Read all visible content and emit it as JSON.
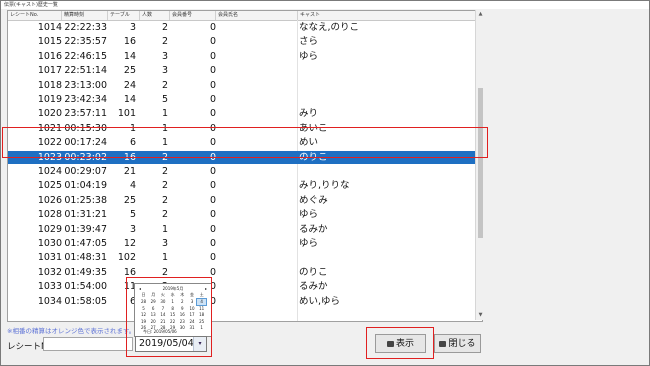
{
  "window": {
    "title": "伝票(キャスト)歴史一覧"
  },
  "columns": [
    "レシートNo.",
    "精算時刻",
    "テーブル",
    "人数",
    "会員番号",
    "会員氏名",
    "キャスト"
  ],
  "rows": [
    {
      "rec": "1014",
      "time": "22:22:33",
      "table": "3",
      "ppl": "2",
      "memno": "0",
      "memname": "",
      "cast": "ななえ,のりこ"
    },
    {
      "rec": "1015",
      "time": "22:35:57",
      "table": "16",
      "ppl": "2",
      "memno": "0",
      "memname": "",
      "cast": "さら"
    },
    {
      "rec": "1016",
      "time": "22:46:15",
      "table": "14",
      "ppl": "3",
      "memno": "0",
      "memname": "",
      "cast": "ゆら"
    },
    {
      "rec": "1017",
      "time": "22:51:14",
      "table": "25",
      "ppl": "3",
      "memno": "0",
      "memname": "",
      "cast": ""
    },
    {
      "rec": "1018",
      "time": "23:13:00",
      "table": "24",
      "ppl": "2",
      "memno": "0",
      "memname": "",
      "cast": ""
    },
    {
      "rec": "1019",
      "time": "23:42:34",
      "table": "14",
      "ppl": "5",
      "memno": "0",
      "memname": "",
      "cast": ""
    },
    {
      "rec": "1020",
      "time": "23:57:11",
      "table": "101",
      "ppl": "1",
      "memno": "0",
      "memname": "",
      "cast": "みり"
    },
    {
      "rec": "1021",
      "time": "00:15:30",
      "table": "1",
      "ppl": "1",
      "memno": "0",
      "memname": "",
      "cast": "あいこ"
    },
    {
      "rec": "1022",
      "time": "00:17:24",
      "table": "6",
      "ppl": "1",
      "memno": "0",
      "memname": "",
      "cast": "めい"
    },
    {
      "rec": "1023",
      "time": "00:23:02",
      "table": "16",
      "ppl": "2",
      "memno": "0",
      "memname": "",
      "cast": "のりこ",
      "selected": true
    },
    {
      "rec": "1024",
      "time": "00:29:07",
      "table": "21",
      "ppl": "2",
      "memno": "0",
      "memname": "",
      "cast": ""
    },
    {
      "rec": "1025",
      "time": "01:04:19",
      "table": "4",
      "ppl": "2",
      "memno": "0",
      "memname": "",
      "cast": "みり,りりな"
    },
    {
      "rec": "1026",
      "time": "01:25:38",
      "table": "25",
      "ppl": "2",
      "memno": "0",
      "memname": "",
      "cast": "めぐみ"
    },
    {
      "rec": "1028",
      "time": "01:31:21",
      "table": "5",
      "ppl": "2",
      "memno": "0",
      "memname": "",
      "cast": "ゆら"
    },
    {
      "rec": "1029",
      "time": "01:39:47",
      "table": "3",
      "ppl": "1",
      "memno": "0",
      "memname": "",
      "cast": "るみか"
    },
    {
      "rec": "1030",
      "time": "01:47:05",
      "table": "12",
      "ppl": "3",
      "memno": "0",
      "memname": "",
      "cast": "ゆら"
    },
    {
      "rec": "1031",
      "time": "01:48:31",
      "table": "102",
      "ppl": "1",
      "memno": "0",
      "memname": "",
      "cast": ""
    },
    {
      "rec": "1032",
      "time": "01:49:35",
      "table": "16",
      "ppl": "2",
      "memno": "0",
      "memname": "",
      "cast": "のりこ"
    },
    {
      "rec": "1033",
      "time": "01:54:00",
      "table": "11",
      "ppl": "2",
      "memno": "0",
      "memname": "",
      "cast": "るみか"
    },
    {
      "rec": "1034",
      "time": "01:58:05",
      "table": "6",
      "ppl": "3",
      "memno": "0",
      "memname": "",
      "cast": "めい,ゆら"
    }
  ],
  "note": "※相番の精算はオレンジ色で表示されます。",
  "receipt_label": "レシートNo.",
  "receipt_value": "",
  "date_value": "2019/05/04",
  "calendar": {
    "title": "2019年5月",
    "weekdays": [
      "日",
      "月",
      "火",
      "水",
      "木",
      "金",
      "土"
    ],
    "weeks": [
      [
        "28",
        "29",
        "30",
        "1",
        "2",
        "3",
        "4"
      ],
      [
        "5",
        "6",
        "7",
        "8",
        "9",
        "10",
        "11"
      ],
      [
        "12",
        "13",
        "14",
        "15",
        "16",
        "17",
        "18"
      ],
      [
        "19",
        "20",
        "21",
        "22",
        "23",
        "24",
        "25"
      ],
      [
        "26",
        "27",
        "28",
        "29",
        "30",
        "31",
        "1"
      ]
    ],
    "today_label": "今日: 2019/05/06"
  },
  "buttons": {
    "show": "表示",
    "close": "閉じる"
  }
}
